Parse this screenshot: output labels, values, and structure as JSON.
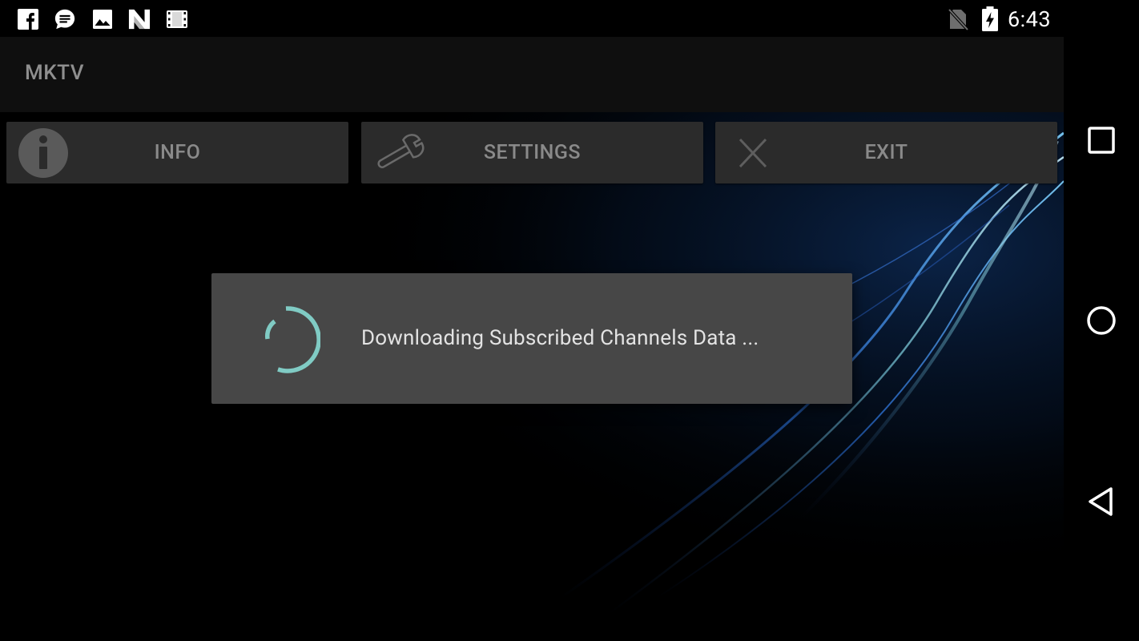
{
  "status_bar": {
    "time": "6:43",
    "left_icons": [
      "facebook-icon",
      "message-icon",
      "image-icon",
      "n-notification-icon",
      "film-icon"
    ],
    "right_icons": [
      "no-sim-icon",
      "battery-charging-icon"
    ]
  },
  "app": {
    "title": "MKTV",
    "buttons": {
      "info_label": "INFO",
      "settings_label": "SETTINGS",
      "exit_label": "EXIT"
    }
  },
  "dialog": {
    "message": "Downloading Subscribed Channels Data ...",
    "spinner_color": "#80CBC4"
  },
  "navigation": {
    "items": [
      "recents-icon",
      "home-icon",
      "back-icon"
    ]
  }
}
